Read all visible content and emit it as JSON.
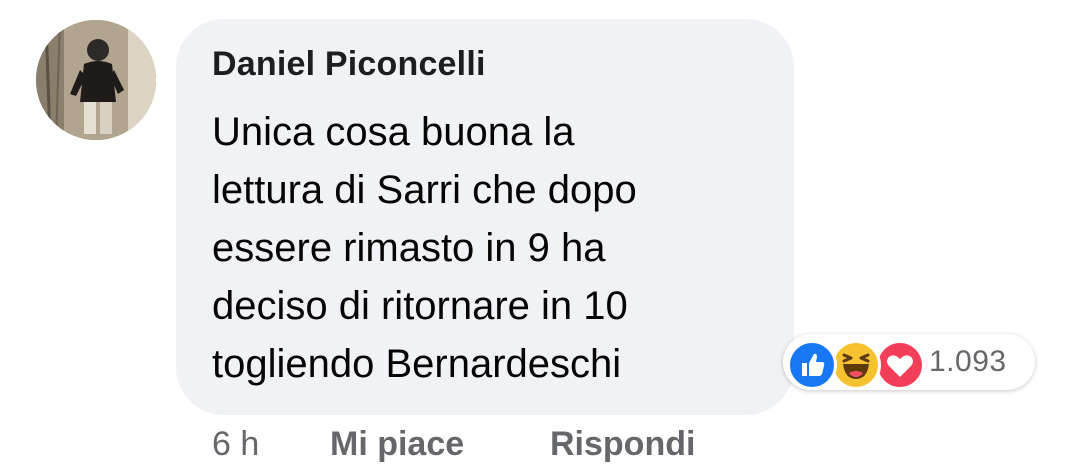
{
  "comment": {
    "author": "Daniel Piconcelli",
    "text_lines": [
      "Unica cosa buona la",
      "lettura di Sarri che dopo",
      "essere rimasto in 9 ha",
      "deciso di ritornare in 10",
      "togliendo Bernardeschi"
    ],
    "reactions": {
      "icons": [
        "like-icon",
        "haha-icon",
        "love-icon"
      ],
      "count": "1.093",
      "colors": {
        "like": "#1877f2",
        "haha": "#f7c22f",
        "love": "#f33e58"
      }
    },
    "actions": {
      "time": "6 h",
      "like_label": "Mi piace",
      "reply_label": "Rispondi"
    }
  }
}
